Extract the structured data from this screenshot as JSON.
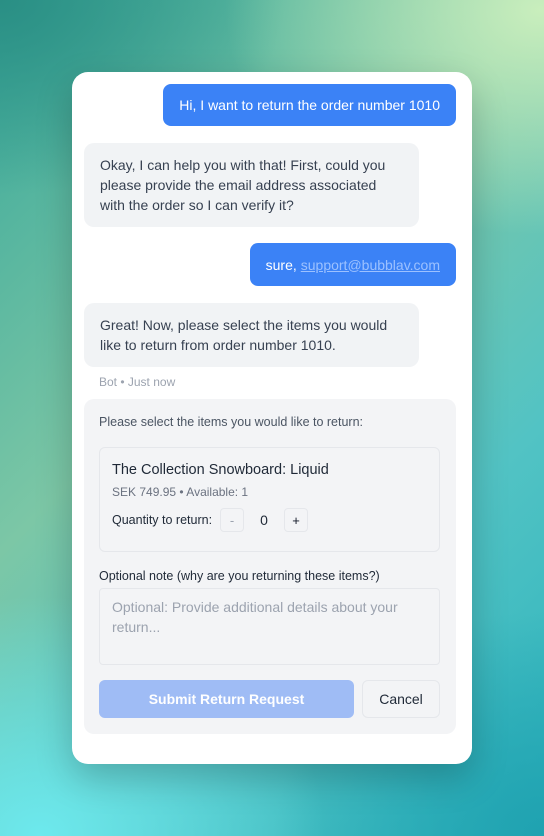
{
  "chat": {
    "messages": [
      {
        "sender": "user",
        "text": "Hi, I want to return the order number 1010"
      },
      {
        "sender": "bot",
        "text": "Okay, I can help you with that! First, could you please provide the email address associated with the order so I can verify it?"
      },
      {
        "sender": "user",
        "text": "sure,",
        "link": "support@bubblav.com"
      },
      {
        "sender": "bot",
        "text": "Great! Now, please select the items you would like to return from order number 1010."
      }
    ],
    "meta": "Bot • Just now"
  },
  "return_form": {
    "prompt": "Please select the items you would like to return:",
    "item": {
      "name": "The Collection Snowboard: Liquid",
      "price": "SEK 749.95",
      "separator": "•",
      "availability": "Available: 1",
      "quantity_label": "Quantity to return:",
      "decrement": "-",
      "quantity": "0",
      "increment": "+"
    },
    "note_label": "Optional note (why are you returning these items?)",
    "note_placeholder": "Optional: Provide additional details about your return...",
    "submit_label": "Submit Return Request",
    "cancel_label": "Cancel"
  },
  "colors": {
    "user_bubble": "#3b82f6",
    "bot_bubble": "#f1f3f5",
    "submit_disabled": "#9fbcf5"
  }
}
